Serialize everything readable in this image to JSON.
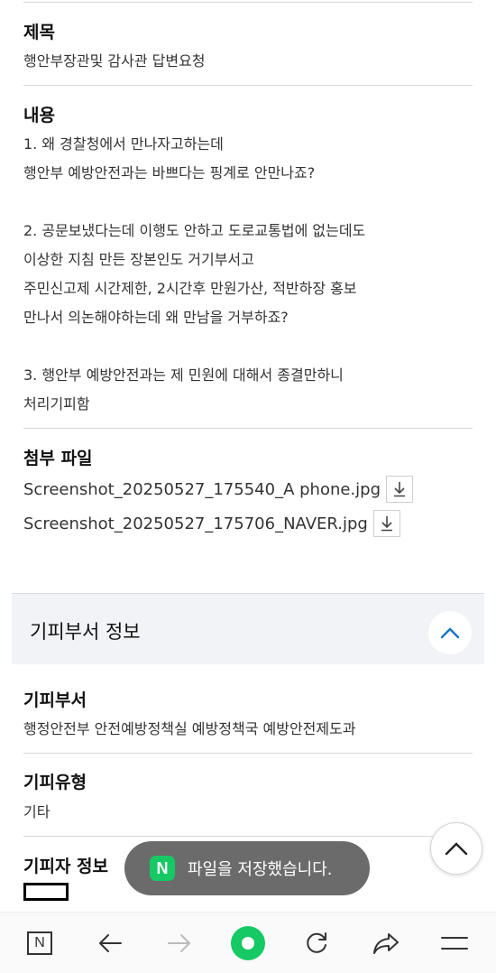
{
  "subject": {
    "label": "제목",
    "value": "행안부장관및 감사관 답변요청"
  },
  "content": {
    "label": "내용",
    "lines": [
      "1.  왜 경찰청에서 만나자고하는데",
      "행안부 예방안전과는  바쁘다는 핑계로 안만나죠?",
      "2. 공문보냈다는데 이행도 안하고 도로교통법에 없는데도",
      "이상한 지침 만든 장본인도 거기부서고",
      "주민신고제 시간제한, 2시간후 만원가산,  적반하장 홍보",
      "만나서 의논해야하는데 왜 만남을 거부하죠?",
      "3. 행안부 예방안전과는 제 민원에 대해서 종결만하니",
      "처리기피함"
    ]
  },
  "attachments": {
    "label": "첨부 파일",
    "files": [
      "Screenshot_20250527_175540_A phone.jpg",
      "Screenshot_20250527_175706_NAVER.jpg"
    ]
  },
  "avoid_section": {
    "title": "기피부서 정보",
    "dept_label": "기피부서",
    "dept_value": "행정안전부 안전예방정책실 예방정책국 예방안전제도과",
    "type_label": "기피유형",
    "type_value": "기타",
    "person_label": "기피자 정보"
  },
  "toast": {
    "logo": "N",
    "message": "파일을 저장했습니다."
  },
  "bottom_bar": {
    "naver_label": "N"
  },
  "colors": {
    "accent_blue": "#1a73c8",
    "naver_green": "#17c964"
  }
}
